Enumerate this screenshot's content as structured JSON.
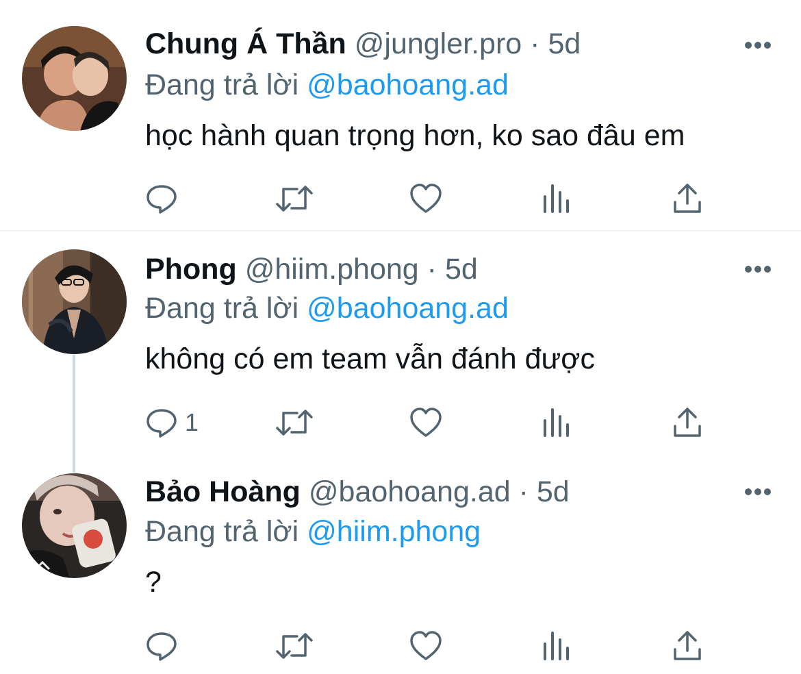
{
  "tweets": [
    {
      "name": "Chung Á Thần",
      "handle": "@jungler.pro",
      "separator": "·",
      "time": "5d",
      "reply_prefix": "Đang trả lời",
      "reply_to": "@baohoang.ad",
      "text": "học hành quan trọng hơn, ko sao đâu em",
      "reply_count": ""
    },
    {
      "name": "Phong",
      "handle": "@hiim.phong",
      "separator": "·",
      "time": "5d",
      "reply_prefix": "Đang trả lời",
      "reply_to": "@baohoang.ad",
      "text": "không có em team vẫn đánh được",
      "reply_count": "1"
    },
    {
      "name": "Bảo Hoàng",
      "handle": "@baohoang.ad",
      "separator": "·",
      "time": "5d",
      "reply_prefix": "Đang trả lời",
      "reply_to": "@hiim.phong",
      "text": "?",
      "reply_count": ""
    }
  ],
  "icons": {
    "reply": "reply-icon",
    "retweet": "retweet-icon",
    "like": "heart-icon",
    "views": "analytics-icon",
    "share": "share-icon",
    "more": "more-icon"
  },
  "colors": {
    "text": "#0f1419",
    "secondary": "#536471",
    "mention": "#1d9bf0",
    "divider": "#eff3f4"
  }
}
